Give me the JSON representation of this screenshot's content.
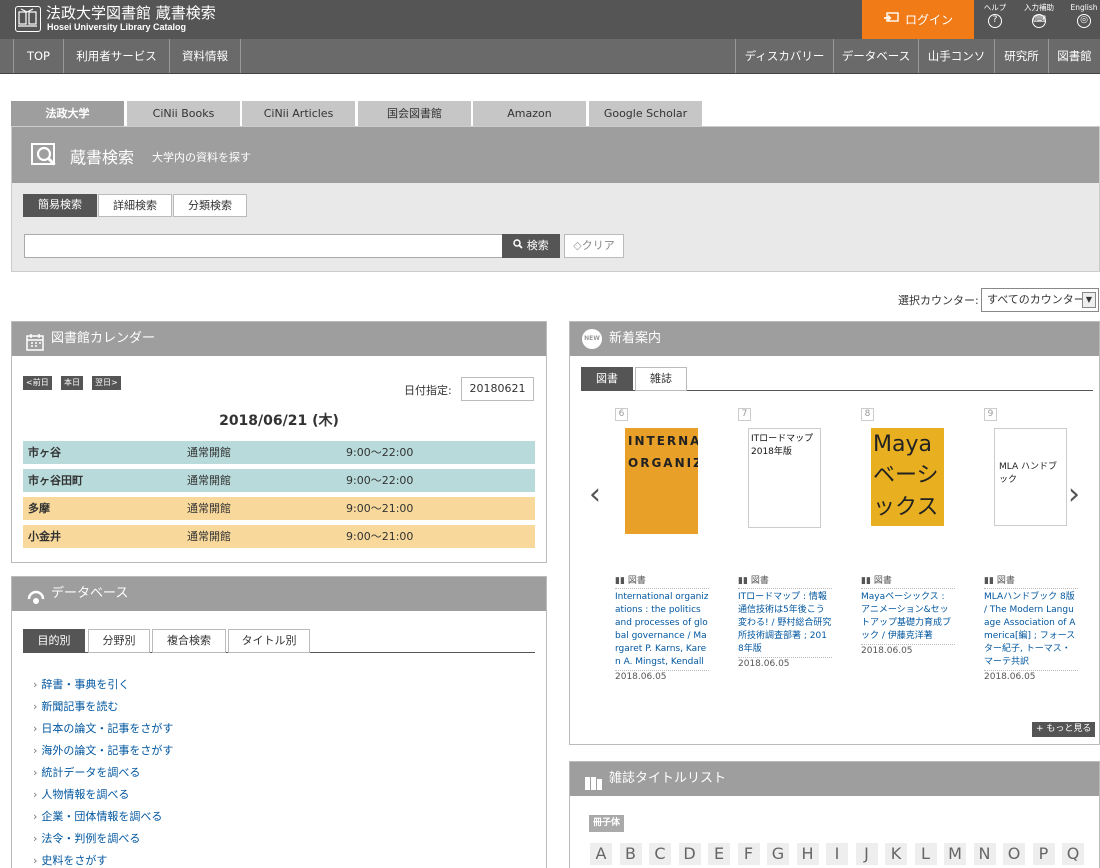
{
  "header": {
    "title": "法政大学図書館 蔵書検索",
    "subtitle": "Hosei University Library Catalog",
    "login": "ログイン",
    "utils": [
      {
        "label": "ヘルプ",
        "icon": "?"
      },
      {
        "label": "入力補助",
        "icon": "⌨"
      },
      {
        "label": "English",
        "icon": "◎"
      }
    ]
  },
  "nav": {
    "left": [
      "TOP",
      "利用者サービス",
      "資料情報"
    ],
    "right": [
      "ディスカバリー",
      "データベース",
      "山手コンソ",
      "研究所",
      "図書館"
    ]
  },
  "search": {
    "tabs": [
      "法政大学",
      "CiNii Books",
      "CiNii Articles",
      "国会図書館",
      "Amazon",
      "Google Scholar"
    ],
    "title": "蔵書検索",
    "desc": "大学内の資料を探す",
    "modes": [
      "簡易検索",
      "詳細検索",
      "分類検索"
    ],
    "search_label": "検索",
    "clear_label": "クリア",
    "counter_label": "選択カウンター:",
    "counter_value": "すべてのカウンター"
  },
  "calendar": {
    "title": "図書館カレンダー",
    "prev": "<前日",
    "today": "本日",
    "next": "翌日>",
    "date_label": "日付指定:",
    "date_value": "20180621",
    "heading": "2018/06/21 (木)",
    "rows": [
      {
        "name": "市ヶ谷",
        "status": "通常開館",
        "hours": "9:00～22:00",
        "color": "#b8dada"
      },
      {
        "name": "市ヶ谷田町",
        "status": "通常開館",
        "hours": "9:00～22:00",
        "color": "#b8dada"
      },
      {
        "name": "多摩",
        "status": "通常開館",
        "hours": "9:00～21:00",
        "color": "#f8d99b"
      },
      {
        "name": "小金井",
        "status": "通常開館",
        "hours": "9:00～21:00",
        "color": "#f8d99b"
      }
    ]
  },
  "database": {
    "title": "データベース",
    "tabs": [
      "目的別",
      "分野別",
      "複合検索",
      "タイトル別"
    ],
    "links": [
      "辞書・事典を引く",
      "新聞記事を読む",
      "日本の論文・記事をさがす",
      "海外の論文・記事をさがす",
      "統計データを調べる",
      "人物情報を調べる",
      "企業・団体情報を調べる",
      "法令・判例を調べる",
      "史料をさがす"
    ]
  },
  "newarrivals": {
    "title": "新着案内",
    "tabs": [
      "図書",
      "雑誌"
    ],
    "more": "+ もっと見る",
    "items": [
      {
        "num": "6",
        "type": "図書",
        "title": "International organizations : the politics and processes of global governance / Margaret P. Karns, Karen A. Mingst, Kendall W. Stiles",
        "date": "2018.06.05"
      },
      {
        "num": "7",
        "type": "図書",
        "title": "ITロードマップ : 情報通信技術は5年後こう変わる! / 野村総合研究所技術調査部著 ; 2018年版",
        "date": "2018.06.05"
      },
      {
        "num": "8",
        "type": "図書",
        "title": "Mayaベーシックス : アニメーション&セットアップ基礎力育成ブック / 伊藤克洋著",
        "date": "2018.06.05"
      },
      {
        "num": "9",
        "type": "図書",
        "title": "MLAハンドブック 8版 / The Modern Language Association of America[編] ; フォースター紀子, トーマス・マーテ共訳",
        "date": "2018.06.05"
      }
    ]
  },
  "journals": {
    "title": "雑誌タイトルリスト",
    "badge": "冊子体",
    "letters": [
      "A",
      "B",
      "C",
      "D",
      "E",
      "F",
      "G",
      "H",
      "I",
      "J",
      "K",
      "L",
      "M",
      "N",
      "O",
      "P",
      "Q"
    ]
  },
  "covers": [
    {
      "text": "INTERNATIONAL ORGANIZATIONS"
    },
    {
      "text": "ITロードマップ 2018年版"
    },
    {
      "text": "Maya ベーシックス"
    },
    {
      "text": "MLA ハンドブック"
    }
  ]
}
